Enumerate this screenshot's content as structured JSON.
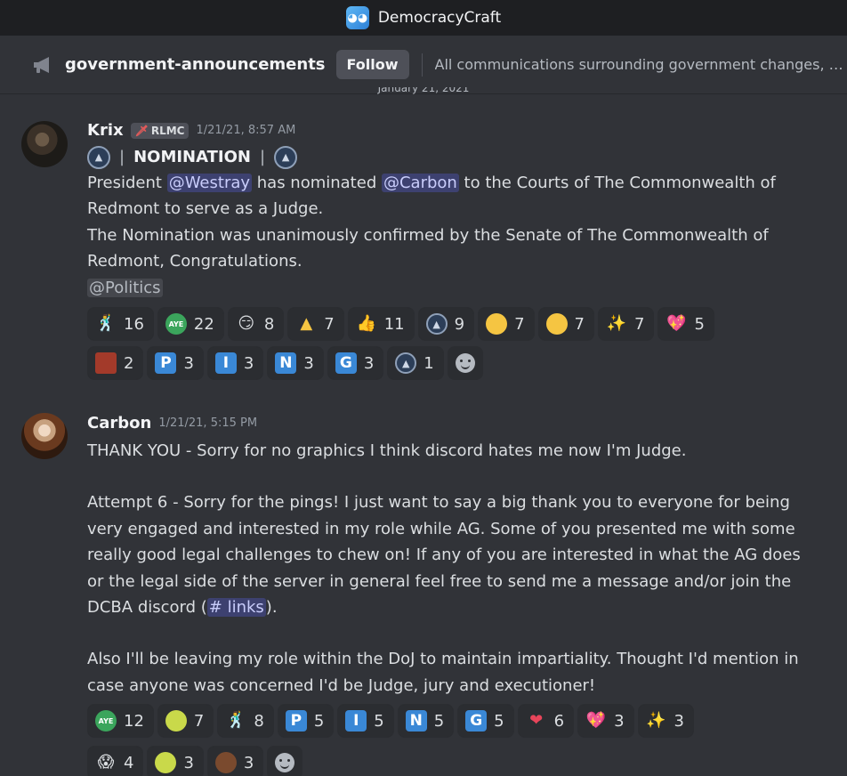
{
  "app": {
    "title": "DemocracyCraft"
  },
  "channel": {
    "name": "government-announcements",
    "follow_label": "Follow",
    "topic": "All communications surrounding government changes, de..."
  },
  "date_divider": "January 21, 2021",
  "messages": [
    {
      "author": "Krix",
      "role_tag": "RLMC",
      "timestamp": "1/21/21, 8:57 AM",
      "nomination_heading": "NOMINATION",
      "line1_pre": "President ",
      "mention_westray": "@Westray",
      "line1_mid": " has nominated ",
      "mention_carbon": "@Carbon",
      "line1_post": "  to the Courts of The Commonwealth of Redmont to serve as a Judge.",
      "line2": "The Nomination was unanimously confirmed by the Senate of The Commonwealth of Redmont, Congratulations.",
      "mention_politics": "@Politics",
      "reactions_row1": [
        {
          "icon": "person-emoji",
          "count": "16"
        },
        {
          "icon": "aye-emoji",
          "count": "22"
        },
        {
          "icon": "smirk-emoji",
          "count": "8"
        },
        {
          "icon": "warning-emoji",
          "count": "7"
        },
        {
          "icon": "thumbs-up-emoji",
          "count": "11"
        },
        {
          "icon": "seal-emoji",
          "count": "9"
        },
        {
          "icon": "grimace-emoji",
          "count": "7"
        },
        {
          "icon": "grimace-alt-emoji",
          "count": "7"
        },
        {
          "icon": "sparkles-emoji",
          "count": "7"
        },
        {
          "icon": "sparkling-heart-emoji",
          "count": "5"
        }
      ],
      "reactions_row2": [
        {
          "icon": "custom-emoji",
          "count": "2"
        },
        {
          "icon": "letter-p",
          "letter": "P",
          "count": "3"
        },
        {
          "icon": "letter-i",
          "letter": "I",
          "count": "3"
        },
        {
          "icon": "letter-n",
          "letter": "N",
          "count": "3"
        },
        {
          "icon": "letter-g",
          "letter": "G",
          "count": "3"
        },
        {
          "icon": "seal-emoji",
          "count": "1"
        }
      ]
    },
    {
      "author": "Carbon",
      "timestamp": "1/21/21, 5:15 PM",
      "p1": "THANK YOU - Sorry for no graphics I think discord hates me now I'm Judge.",
      "p2_pre": "Attempt 6 - Sorry for the pings! I just want to say a big thank you to everyone for being very engaged and interested in my role while AG. Some of you presented me with some really good legal challenges to chew on! If any of you are interested in what the AG does or the legal side of the server in general feel free to send me a message and/or join the DCBA discord (",
      "channel_link": "# links",
      "p2_post": ").",
      "p3": "Also I'll be leaving my role within the DoJ to maintain impartiality. Thought I'd mention in case anyone was concerned I'd be Judge, jury and executioner!",
      "reactions_row1": [
        {
          "icon": "aye-emoji",
          "count": "12"
        },
        {
          "icon": "tennis-emoji",
          "count": "7"
        },
        {
          "icon": "person-emoji",
          "count": "8"
        },
        {
          "icon": "letter-p",
          "letter": "P",
          "count": "5"
        },
        {
          "icon": "letter-i",
          "letter": "I",
          "count": "5"
        },
        {
          "icon": "letter-n",
          "letter": "N",
          "count": "5"
        },
        {
          "icon": "letter-g",
          "letter": "G",
          "count": "5"
        },
        {
          "icon": "red-heart-emoji",
          "count": "6"
        },
        {
          "icon": "sparkling-heart-emoji",
          "count": "3"
        },
        {
          "icon": "sparkles-emoji",
          "count": "3"
        }
      ],
      "reactions_row2": [
        {
          "icon": "viking-emoji",
          "count": "4"
        },
        {
          "icon": "ball-emoji",
          "count": "3"
        },
        {
          "icon": "guy-emoji",
          "count": "3"
        }
      ]
    }
  ]
}
